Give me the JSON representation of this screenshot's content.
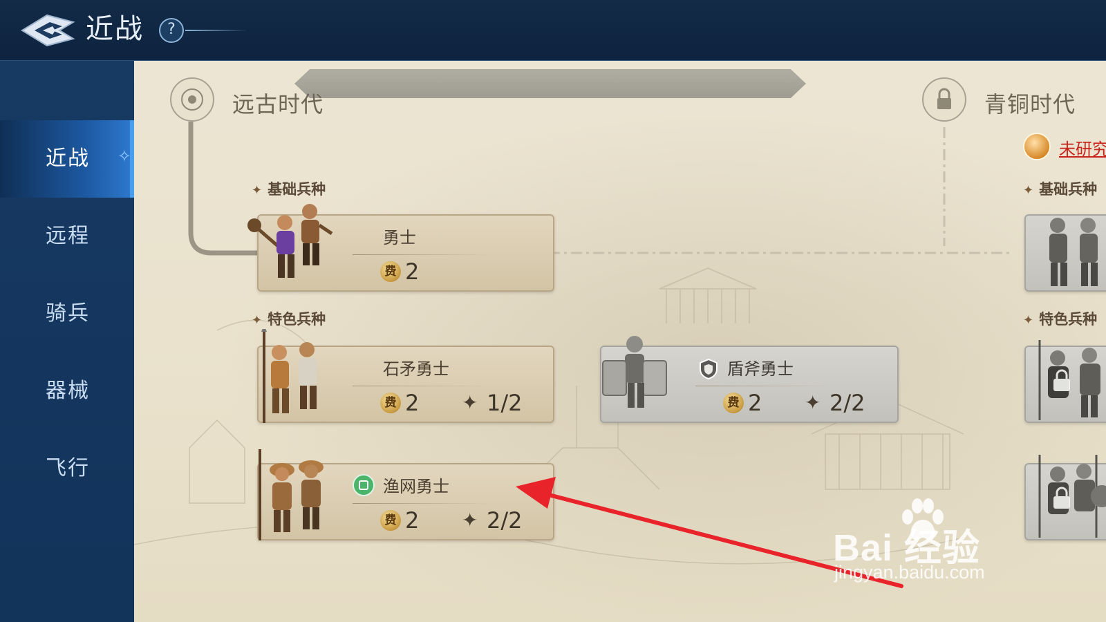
{
  "header": {
    "title": "近战",
    "help_symbol": "?"
  },
  "sidebar": {
    "items": [
      {
        "label": "近战",
        "active": true
      },
      {
        "label": "远程",
        "active": false
      },
      {
        "label": "骑兵",
        "active": false
      },
      {
        "label": "器械",
        "active": false
      },
      {
        "label": "飞行",
        "active": false
      }
    ]
  },
  "eras": [
    {
      "title": "远古时代",
      "locked": false,
      "sections": [
        {
          "label": "基础兵种",
          "units": [
            {
              "name": "勇士",
              "cost_symbol": "费",
              "cost": "2",
              "capacity": ""
            }
          ]
        },
        {
          "label": "特色兵种",
          "units": [
            {
              "name": "石矛勇士",
              "cost_symbol": "费",
              "cost": "2",
              "capacity": "1/2",
              "locked": false
            },
            {
              "name": "盾斧勇士",
              "cost_symbol": "费",
              "cost": "2",
              "capacity": "2/2",
              "locked": true,
              "badge": "shield-icon"
            },
            {
              "name": "渔网勇士",
              "cost_symbol": "费",
              "cost": "2",
              "capacity": "2/2",
              "locked": false,
              "badge": "net-icon"
            }
          ]
        }
      ]
    },
    {
      "title": "青铜时代",
      "locked": true,
      "status": "未研究",
      "sections": [
        {
          "label": "基础兵种"
        },
        {
          "label": "特色兵种"
        }
      ]
    }
  ],
  "watermark": {
    "brand": "Bai  经验",
    "url": "jingyan.baidu.com"
  },
  "colors": {
    "sidebar_active": "#2f7ad0",
    "parchment": "#ece5d3",
    "unlock_text": "#c8241c",
    "arrow": "#e8232a"
  }
}
